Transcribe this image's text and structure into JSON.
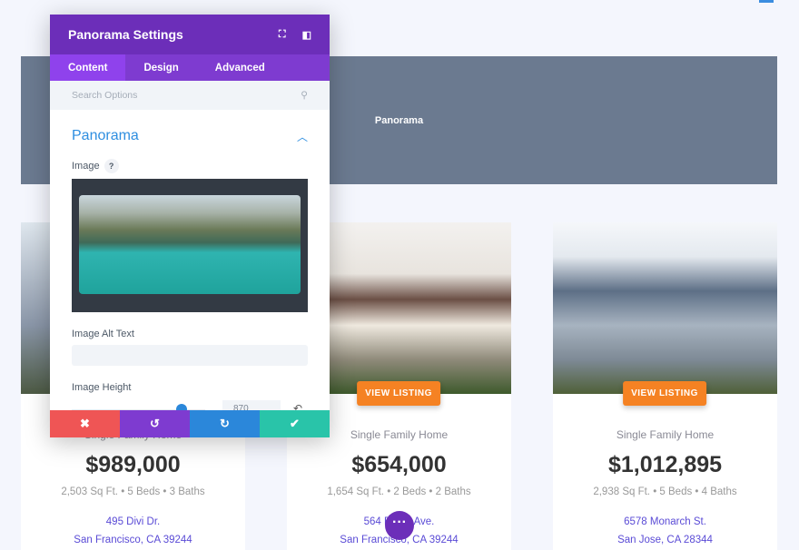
{
  "banner": {
    "title": "Panorama"
  },
  "panel": {
    "title": "Panorama Settings",
    "tabs": [
      "Content",
      "Design",
      "Advanced"
    ],
    "search_placeholder": "Search Options",
    "section": "Panorama",
    "image_label": "Image",
    "help": "?",
    "alt_label": "Image Alt Text",
    "height_label": "Image Height",
    "height_value": "870",
    "height_slider_percent": 65
  },
  "listing_button": "VIEW LISTING",
  "listings": [
    {
      "type": "Single Family Home",
      "price": "$989,000",
      "meta": "2,503 Sq Ft. • 5 Beds • 3 Baths",
      "addr1": "495 Divi Dr.",
      "addr2": "San Francisco, CA 39244"
    },
    {
      "type": "Single Family Home",
      "price": "$654,000",
      "meta": "1,654 Sq Ft. • 2 Beds • 2 Baths",
      "addr1": "564 B      t Ave.",
      "addr2": "San Francisco, CA 39244"
    },
    {
      "type": "Single Family Home",
      "price": "$1,012,895",
      "meta": "2,938 Sq Ft. • 5 Beds • 4 Baths",
      "addr1": "6578 Monarch St.",
      "addr2": "San Jose, CA 28344"
    }
  ],
  "colors": {
    "purple": "#6c2eb9",
    "orange": "#f58223",
    "cancel": "#ef5555",
    "undo": "#7e3bd0",
    "redo": "#2b87da",
    "save": "#29c4a9"
  }
}
